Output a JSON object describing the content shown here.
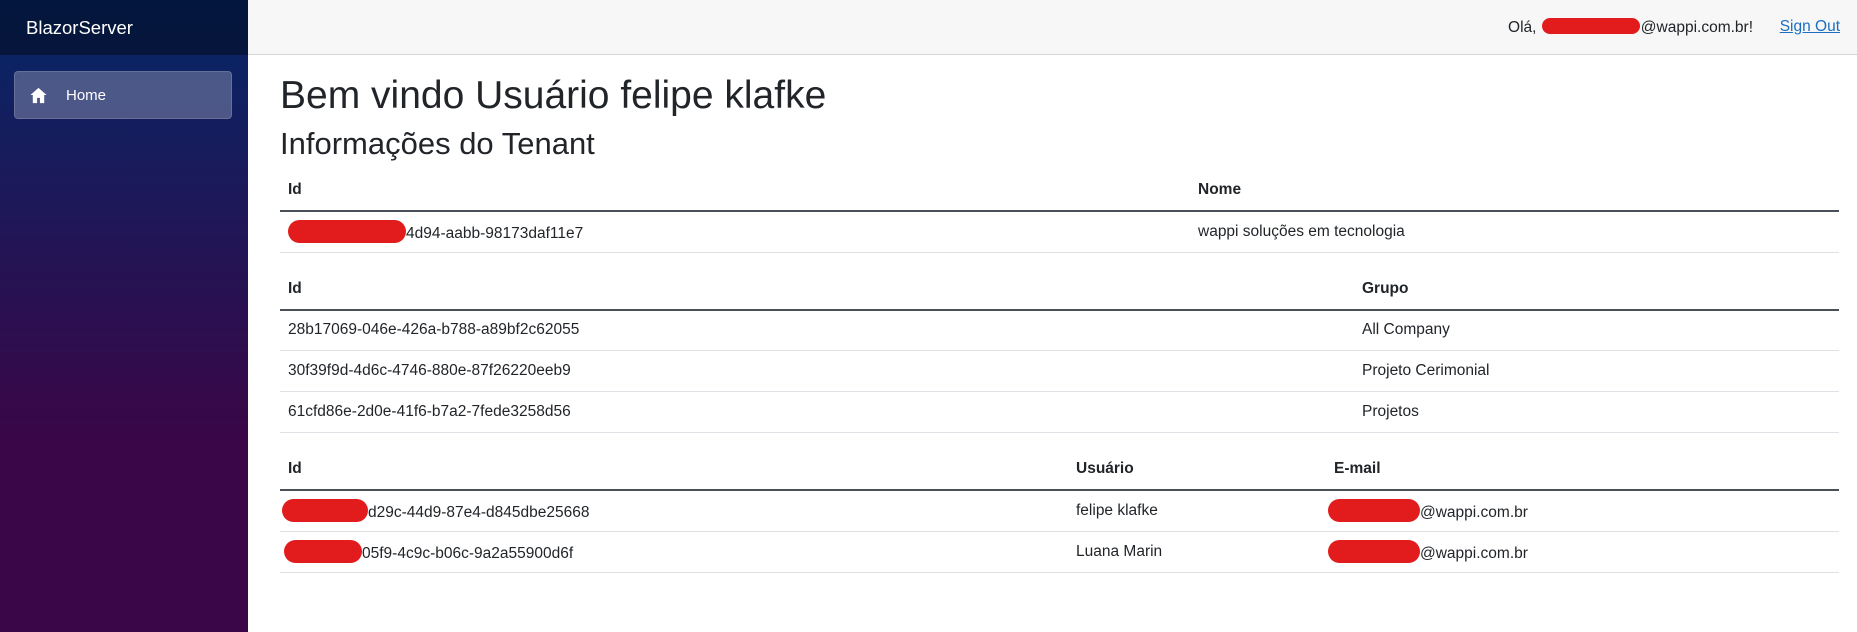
{
  "brand": "BlazorServer",
  "nav": {
    "home_label": "Home",
    "home_icon": "home-icon"
  },
  "topbar": {
    "greeting_prefix": "Olá, ",
    "greeting_suffix": "@wappi.com.br!",
    "signout_label": "Sign Out"
  },
  "main": {
    "welcome_title": "Bem vindo Usuário felipe klafke",
    "tenant_title": "Informações do Tenant"
  },
  "tenant_table": {
    "headers": [
      "Id",
      "Nome"
    ],
    "rows": [
      {
        "id": "4d94-aabb-98173daf11e7",
        "nome": "wappi soluções em tecnologia"
      }
    ]
  },
  "groups_table": {
    "headers": [
      "Id",
      "Grupo"
    ],
    "rows": [
      {
        "id": "28b17069-046e-426a-b788-a89bf2c62055",
        "grupo": "All Company"
      },
      {
        "id": "30f39f9d-4d6c-4746-880e-87f26220eeb9",
        "grupo": "Projeto Cerimonial"
      },
      {
        "id": "61cfd86e-2d0e-41f6-b7a2-7fede3258d56",
        "grupo": "Projetos"
      }
    ]
  },
  "users_table": {
    "headers": [
      "Id",
      "Usuário",
      "E-mail"
    ],
    "rows": [
      {
        "id": "d29c-44d9-87e4-d845dbe25668",
        "usuario": "felipe klafke",
        "email": "@wappi.com.br"
      },
      {
        "id": "05f9-4c9c-b06c-9a2a55900d6f",
        "usuario": "Luana Marin",
        "email": "@wappi.com.br"
      }
    ]
  },
  "colors": {
    "link": "#1b6ec2",
    "redaction": "#e21c1c",
    "sidebar_top": "#052767",
    "sidebar_bottom": "#3a0647"
  }
}
